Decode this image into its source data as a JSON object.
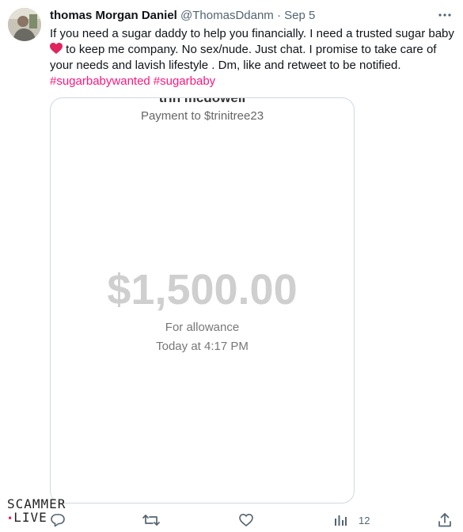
{
  "tweet": {
    "author": {
      "display_name": "thomas Morgan Daniel",
      "handle": "@ThomasDdanm",
      "separator": "·",
      "date": "Sep 5"
    },
    "text": {
      "line_part1": "If you need a sugar daddy to help you financially. I need a trusted sugar baby",
      "line_part2": " to keep me company. No sex/nude. Just chat. I promise to take care of your needs and lavish lifestyle . Dm, like and retweet to be notified.",
      "hashtags": [
        "#sugarbabywanted",
        "#sugarbaby"
      ]
    },
    "media": {
      "recipient_name_cut": "trin mcdowell",
      "payment_to": "Payment to $trinitree23",
      "amount": "$1,500.00",
      "memo": "For allowance",
      "timestamp": "Today at 4:17 PM"
    },
    "actions": {
      "reply_count": "",
      "retweet_count": "",
      "like_count": "",
      "views_count": "12"
    }
  },
  "watermark": {
    "line1": "SCAMMER",
    "line2": "LIVE"
  },
  "colors": {
    "hashtag": "#f91880",
    "heart": "#e0245e",
    "secondary_text": "#536471",
    "card_border": "#cfd9de"
  },
  "icons": [
    "more-icon",
    "heart-emoji-icon",
    "reply-icon",
    "retweet-icon",
    "like-icon",
    "views-icon",
    "share-icon"
  ]
}
